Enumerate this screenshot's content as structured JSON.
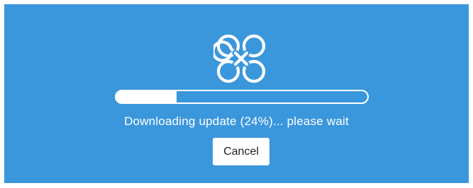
{
  "dialog": {
    "logo_icon": "quatrefoil-loops-icon",
    "progress_fraction": 0.24,
    "status_text": "Downloading update (24%)... please wait",
    "cancel_label": "Cancel"
  },
  "colors": {
    "background": "#3a97dc",
    "foreground": "#ffffff",
    "button_text": "#222222"
  }
}
